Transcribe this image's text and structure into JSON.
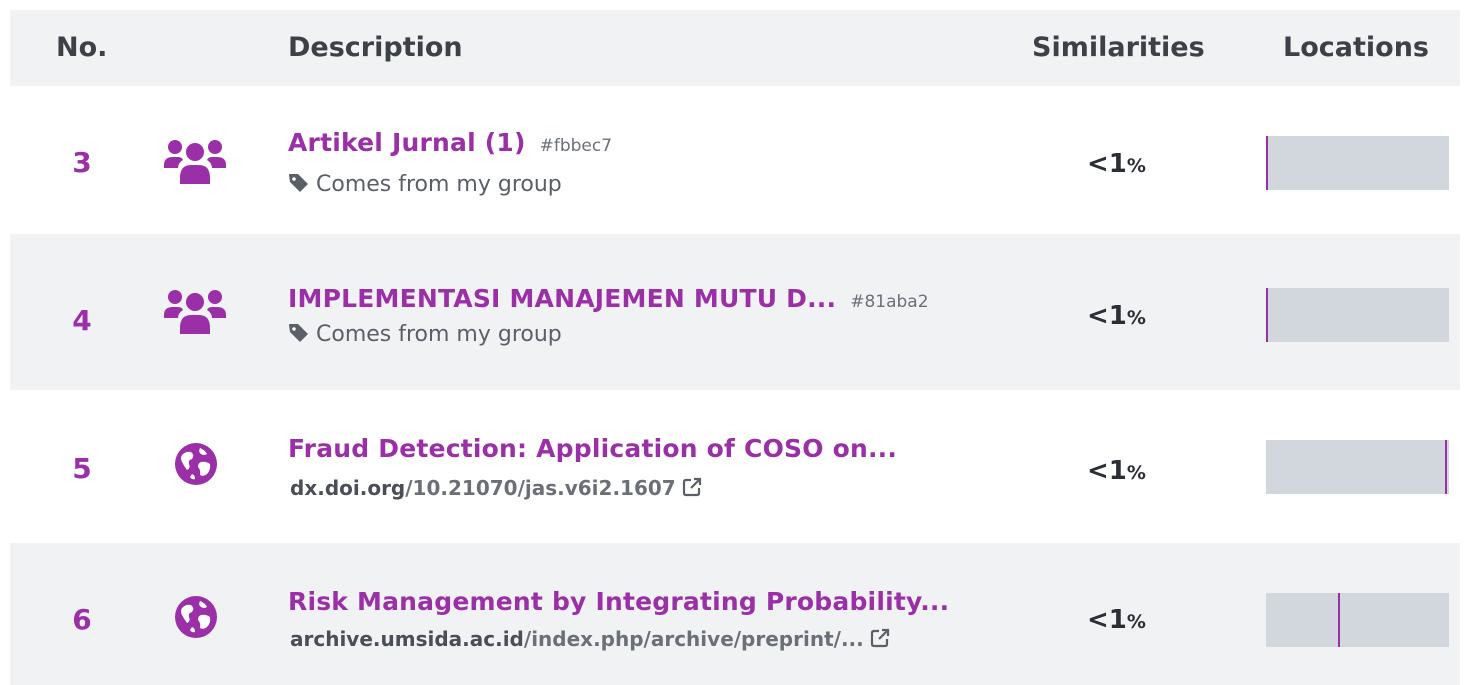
{
  "header": {
    "no": "No.",
    "description": "Description",
    "similarities": "Similarities",
    "locations": "Locations"
  },
  "accent_color": "#9b2fa7",
  "rows": [
    {
      "no": "3",
      "icon": "group-icon",
      "title": "Artikel Jurnal (1)",
      "hash": "#fbbec7",
      "subtitle": "Comes from my group",
      "similarity": "<1",
      "percent_sign": "%",
      "location_fraction": 0.0
    },
    {
      "no": "4",
      "icon": "group-icon",
      "title": "IMPLEMENTASI MANAJEMEN MUTU D...",
      "hash": "#81aba2",
      "subtitle": "Comes from my group",
      "similarity": "<1",
      "percent_sign": "%",
      "location_fraction": 0.0
    },
    {
      "no": "5",
      "icon": "globe-icon",
      "title": "Fraud Detection: Application of COSO on...",
      "url_host": "dx.doi.org",
      "url_path": "/10.21070/jas.v6i2.1607",
      "similarity": "<1",
      "percent_sign": "%",
      "location_fraction": 0.99
    },
    {
      "no": "6",
      "icon": "globe-icon",
      "title": "Risk Management by Integrating Probability...",
      "url_host": "archive.umsida.ac.id",
      "url_path": "/index.php/archive/preprint/...",
      "similarity": "<1",
      "percent_sign": "%",
      "location_fraction": 0.4
    }
  ]
}
